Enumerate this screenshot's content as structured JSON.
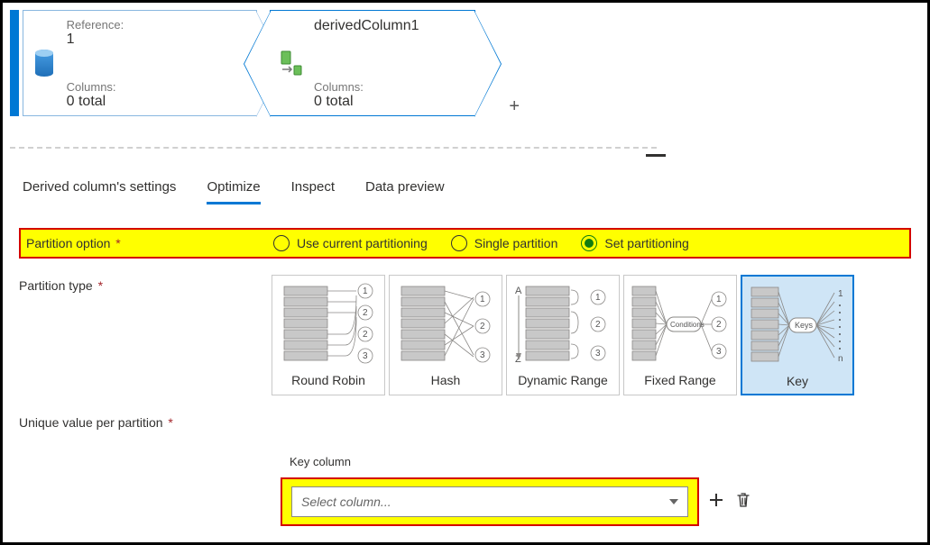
{
  "nodes": {
    "source": {
      "ref_label": "Reference:",
      "ref_value": "1",
      "cols_label": "Columns:",
      "cols_value": "0 total"
    },
    "derived": {
      "title": "derivedColumn1",
      "cols_label": "Columns:",
      "cols_value": "0 total"
    },
    "add": "+"
  },
  "tabs": {
    "settings": "Derived column's settings",
    "optimize": "Optimize",
    "inspect": "Inspect",
    "preview": "Data preview"
  },
  "partition_option": {
    "label": "Partition option",
    "opt_current": "Use current partitioning",
    "opt_single": "Single partition",
    "opt_set": "Set partitioning"
  },
  "partition_type": {
    "label": "Partition type",
    "round_robin": "Round Robin",
    "hash": "Hash",
    "dynamic": "Dynamic Range",
    "fixed": "Fixed Range",
    "key": "Key"
  },
  "unique": {
    "label": "Unique value per partition",
    "key_column": "Key column",
    "select_placeholder": "Select column..."
  },
  "glyph": {
    "conditions": "Conditions",
    "keys": "Keys",
    "a": "A",
    "z": "Z",
    "one": "1",
    "n": "n"
  }
}
